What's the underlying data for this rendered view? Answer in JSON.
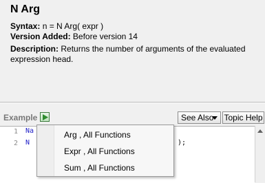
{
  "help": {
    "title": "N Arg",
    "syntax_label": "Syntax:",
    "syntax_value": "n = N Arg( expr )",
    "version_label": "Version Added:",
    "version_value": "Before version 14",
    "description_label": "Description:",
    "description_line1": "Returns the number of arguments of the evaluated",
    "description_line2": "expression head."
  },
  "toolbar": {
    "example_label": "Example",
    "run_icon": "run-script-icon",
    "see_also_label": "See Also",
    "topic_help_label": "Topic Help"
  },
  "editor": {
    "line_numbers": [
      "1",
      "2"
    ],
    "line1_fragment": "Na",
    "line2_fragment": "N",
    "line2_tail": ");"
  },
  "see_also_menu": {
    "items": [
      {
        "label": "Arg , All Functions"
      },
      {
        "label": "Expr , All Functions"
      },
      {
        "label": "Sum , All Functions"
      }
    ]
  },
  "colors": {
    "code_text": "#1d1dc7",
    "run_button": "#2e8b2e"
  }
}
